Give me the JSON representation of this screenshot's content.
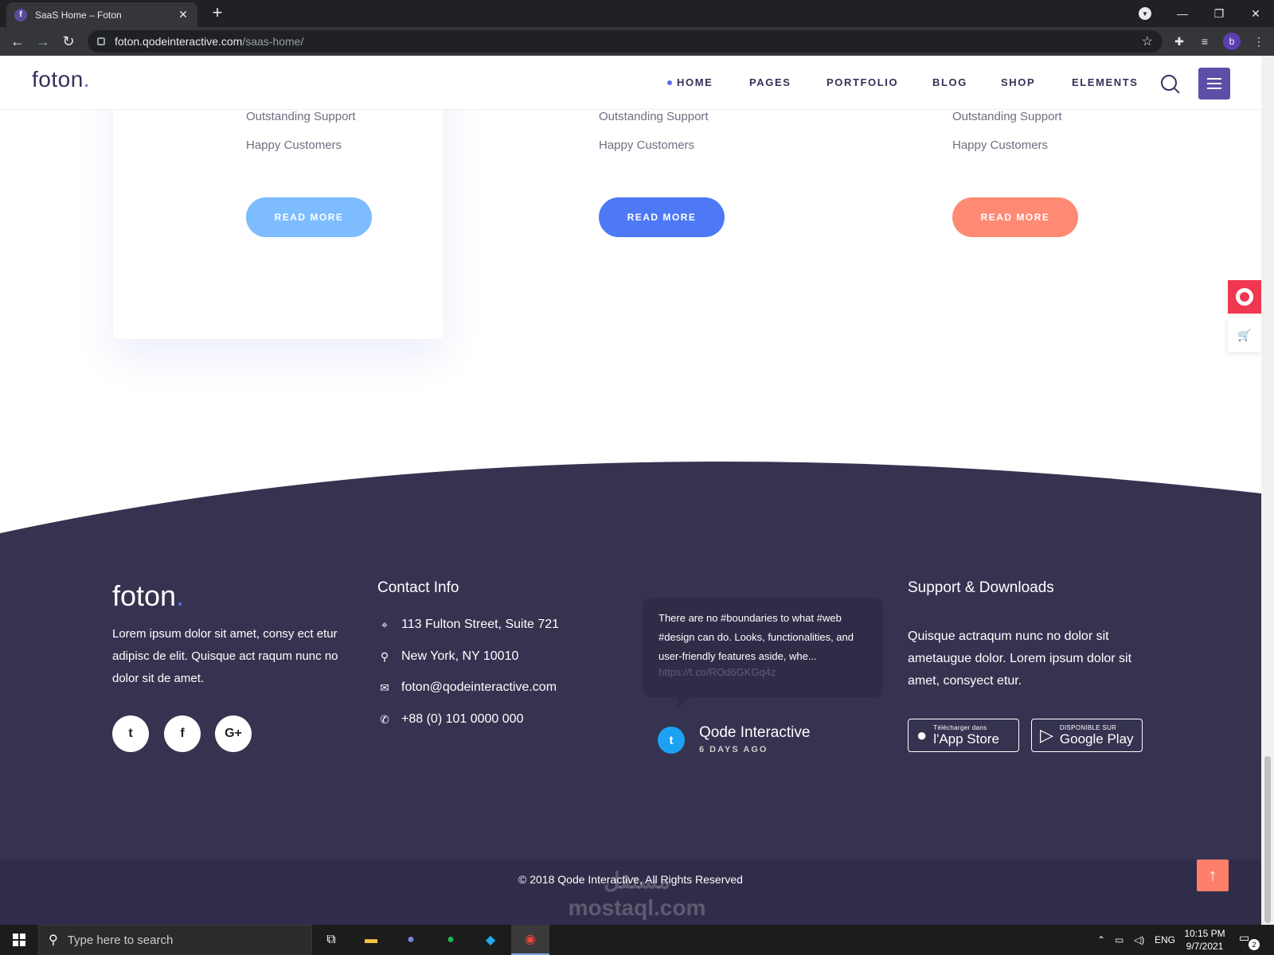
{
  "browser": {
    "tab_title": "SaaS Home – Foton",
    "favicon_letter": "f",
    "url_host": "foton.qodeinteractive.com",
    "url_path": "/saas-home/",
    "profile_letter": "b"
  },
  "header": {
    "logo": "foton",
    "logo_dot": ".",
    "nav": [
      "HOME",
      "PAGES",
      "PORTFOLIO",
      "BLOG",
      "SHOP",
      "ELEMENTS"
    ]
  },
  "plans": [
    {
      "features": [
        "Outstanding Support",
        "Happy Customers"
      ],
      "button": "READ MORE",
      "button_color": "#7cbcff"
    },
    {
      "features": [
        "Outstanding Support",
        "Happy Customers"
      ],
      "button": "READ MORE",
      "button_color": "#4d79f6"
    },
    {
      "features": [
        "Outstanding Support",
        "Happy Customers"
      ],
      "button": "READ MORE",
      "button_color": "#ff8a73"
    }
  ],
  "footer": {
    "logo": "foton",
    "logo_dot": ".",
    "about": "Lorem ipsum dolor sit amet, consy ect etur adipisc de elit. Quisque act raqum nunc no dolor sit de amet.",
    "social": [
      {
        "icon": "twitter-icon",
        "glyph": "t"
      },
      {
        "icon": "facebook-icon",
        "glyph": "f"
      },
      {
        "icon": "google-plus-icon",
        "glyph": "G+"
      }
    ],
    "contact_heading": "Contact Info",
    "contact": [
      {
        "icon": "location-pin-icon",
        "text": "113 Fulton Street, Suite 721"
      },
      {
        "icon": "pushpin-icon",
        "text": "New York, NY 10010"
      },
      {
        "icon": "envelope-icon",
        "text": "foton@qodeinteractive.com"
      },
      {
        "icon": "phone-icon",
        "text": "+88 (0) 101 0000 000"
      }
    ],
    "tweet": {
      "text": "There are no #boundaries to what #web #design can do. Looks, functionalities, and user-friendly features aside, whe...",
      "link": "https://t.co/ROd6GKGq4z",
      "author": "Qode Interactive",
      "date": "6 DAYS AGO"
    },
    "support_heading": "Support & Downloads",
    "support_text": "Quisque actraqum nunc no dolor sit ametaugue dolor. Lorem ipsum dolor sit amet, consyect etur.",
    "app_store": {
      "small": "Télécharger dans",
      "big": "l'App Store"
    },
    "google_play": {
      "small": "DISPONIBLE SUR",
      "big": "Google Play"
    },
    "copyright": "© 2018 Qode Interactive, All Rights Reserved"
  },
  "watermark": {
    "arabic": "مستقل",
    "latin": "mostaql.com"
  },
  "taskbar": {
    "search_placeholder": "Type here to search",
    "lang": "ENG",
    "time": "10:15 PM",
    "date": "9/7/2021",
    "notifications": "2"
  },
  "colors": {
    "accent": "#5b6df0",
    "footer_bg": "#353350",
    "menu_button": "#5c4fa8",
    "back_to_top": "#ff7f6a"
  }
}
